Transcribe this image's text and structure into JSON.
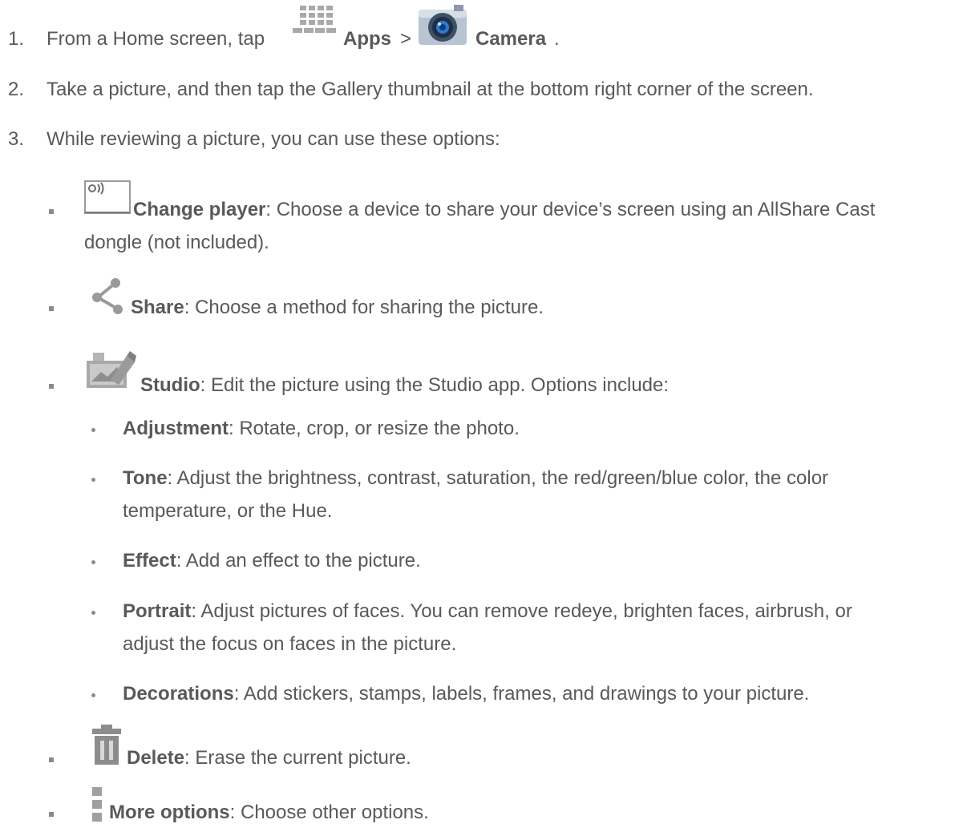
{
  "steps": [
    {
      "number": "1.",
      "before": "From a Home screen, tap",
      "apps": "Apps",
      "sep": ">",
      "camera": "Camera",
      "end": "."
    },
    {
      "number": "2.",
      "text": "Take a picture, and then tap the Gallery thumbnail at the bottom right corner of the screen."
    },
    {
      "number": "3.",
      "text": "While reviewing a picture, you can use these options:"
    }
  ],
  "options": {
    "change_player": {
      "label": "Change player",
      "line1": ": Choose a device to share your device’s screen using an AllShare Cast",
      "line2": "dongle (not included)."
    },
    "share": {
      "label": "Share",
      "desc": ": Choose a method for sharing the picture."
    },
    "studio": {
      "label": "Studio",
      "desc": ": Edit the picture using the Studio app. Options include:"
    },
    "delete": {
      "label": "Delete",
      "desc": ": Erase the current picture."
    },
    "more": {
      "label": "More options",
      "desc": ": Choose other options."
    }
  },
  "studio_items": [
    {
      "label": "Adjustment",
      "line1": ": Rotate, crop, or resize the photo."
    },
    {
      "label": "Tone",
      "line1": ": Adjust the brightness, contrast, saturation, the red/green/blue color, the color",
      "line2": "temperature, or the Hue."
    },
    {
      "label": "Effect",
      "line1": ": Add an effect to the picture."
    },
    {
      "label": "Portrait",
      "line1": ": Adjust pictures of faces. You can remove redeye, brighten faces, airbrush, or",
      "line2": "adjust the focus on faces in the picture."
    },
    {
      "label": "Decorations",
      "line1": ": Add stickers, stamps, labels, frames, and drawings to your picture."
    }
  ],
  "icons": [
    "apps-grid-icon",
    "camera-icon",
    "change-player-icon",
    "share-icon",
    "studio-icon",
    "delete-icon",
    "more-options-icon"
  ],
  "colors": {
    "text": "#595959",
    "bullet": "#8a8a8a",
    "icon_gray": "#9a9a9a"
  }
}
